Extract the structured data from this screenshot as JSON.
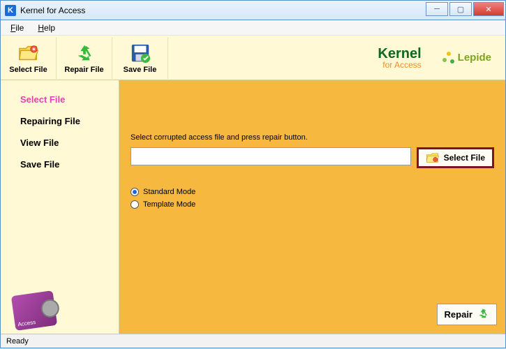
{
  "window": {
    "title": "Kernel for Access"
  },
  "menubar": {
    "file": "File",
    "help": "Help"
  },
  "toolbar": {
    "select_file": "Select File",
    "repair_file": "Repair File",
    "save_file": "Save File"
  },
  "brand": {
    "kernel_line1": "Kernel",
    "kernel_line2": "for Access",
    "lepide": "Lepide"
  },
  "sidebar": {
    "items": [
      {
        "label": "Select File",
        "selected": true
      },
      {
        "label": "Repairing File",
        "selected": false
      },
      {
        "label": "View File",
        "selected": false
      },
      {
        "label": "Save File",
        "selected": false
      }
    ]
  },
  "main": {
    "instruction": "Select corrupted access file and press repair button.",
    "file_path": "",
    "select_button": "Select File",
    "modes": {
      "standard": "Standard Mode",
      "template": "Template Mode",
      "selected": "standard"
    },
    "repair_button": "Repair"
  },
  "statusbar": {
    "text": "Ready"
  }
}
